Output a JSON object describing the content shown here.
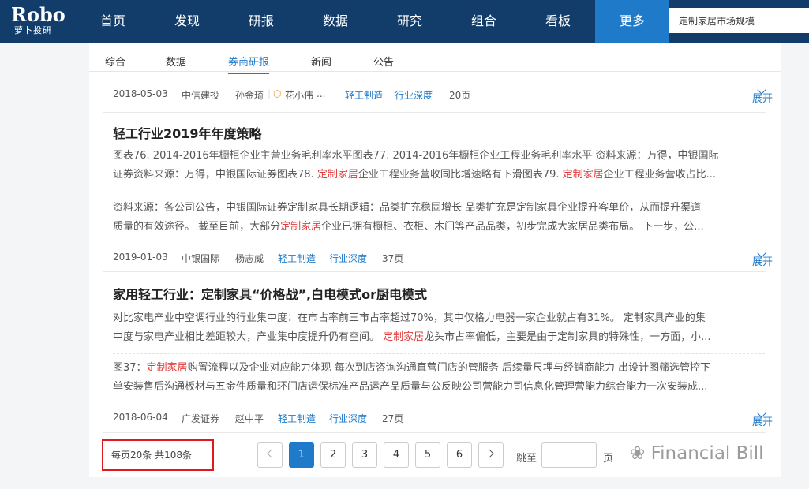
{
  "logo": {
    "brand": "Robo",
    "sub": "萝卜投研"
  },
  "nav": {
    "items": [
      "首页",
      "发现",
      "研报",
      "数据",
      "研究",
      "组合",
      "看板",
      "更多"
    ],
    "active_index": 7
  },
  "search": {
    "value": "定制家居市场规模"
  },
  "subtabs": {
    "items": [
      "综合",
      "数据",
      "券商研报",
      "新闻",
      "公告"
    ],
    "active_index": 2
  },
  "reports": [
    {
      "meta": {
        "date": "2018-05-03",
        "broker": "中信建投",
        "author1": "孙金琦",
        "author2": "花小伟",
        "ellipsis": "...",
        "tag1": "轻工制造",
        "tag2": "行业深度",
        "pages": "20页",
        "expand": "展开"
      }
    },
    {
      "title": "轻工行业2019年年度策略",
      "para1": [
        {
          "parts": [
            {
              "t": "图表76. 2014-2016年橱柜企业主营业务毛利率水平图表77. 2014-2016年橱柜企业工程业务毛利率水平 资料来源：万得，中银国际",
              "hl": false
            }
          ]
        },
        {
          "parts": [
            {
              "t": "证券资料来源：万得，中银国际证券图表78. ",
              "hl": false
            },
            {
              "t": "定制家居",
              "hl": true
            },
            {
              "t": "企业工程业务营收同比增速略有下滑图表79. ",
              "hl": false
            },
            {
              "t": "定制家居",
              "hl": true
            },
            {
              "t": "企业工程业务营收占比...",
              "hl": false
            }
          ]
        }
      ],
      "para2": [
        {
          "parts": [
            {
              "t": "资料来源：各公司公告，中银国际证券定制家具长期逻辑：品类扩充稳固增长 品类扩充是定制家具企业提升客单价，从而提升渠道",
              "hl": false
            }
          ]
        },
        {
          "parts": [
            {
              "t": "质量的有效途径。 截至目前，大部分",
              "hl": false
            },
            {
              "t": "定制家居",
              "hl": true
            },
            {
              "t": "企业已拥有橱柜、衣柜、木门等产品品类，初步完成大家居品类布局。 下一步，公...",
              "hl": false
            }
          ]
        }
      ],
      "meta": {
        "date": "2019-01-03",
        "broker": "中银国际",
        "author1": "杨志威",
        "tag1": "轻工制造",
        "tag2": "行业深度",
        "pages": "37页",
        "expand": "展开"
      }
    },
    {
      "title": "家用轻工行业：定制家具“价格战”,白电模式or厨电模式",
      "para1": [
        {
          "parts": [
            {
              "t": "对比家电产业中空调行业的行业集中度：在市占率前三市占率超过70%，其中仅格力电器一家企业就占有31%。 定制家具产业的集",
              "hl": false
            }
          ]
        },
        {
          "parts": [
            {
              "t": "中度与家电产业相比差距较大，产业集中度提升仍有空间。 ",
              "hl": false
            },
            {
              "t": "定制家居",
              "hl": true
            },
            {
              "t": "龙头市占率偏低，主要是由于定制家具的特殊性，一方面，小...",
              "hl": false
            }
          ]
        }
      ],
      "para2": [
        {
          "parts": [
            {
              "t": "图37：",
              "hl": false
            },
            {
              "t": "定制家居",
              "hl": true
            },
            {
              "t": "购置流程以及企业对应能力体现 每次到店咨询沟通直营门店的管服务 后续量尺埋与经销商能力 出设计图筛选管控下",
              "hl": false
            }
          ]
        },
        {
          "parts": [
            {
              "t": "单安装售后沟通板材与五金件质量和环门店运保标准产品运产品质量与公反映公司营能力司信息化管理营能力综合能力一次安装成...",
              "hl": false
            }
          ]
        }
      ],
      "meta": {
        "date": "2018-06-04",
        "broker": "广发证券",
        "author1": "赵中平",
        "tag1": "轻工制造",
        "tag2": "行业深度",
        "pages": "27页",
        "expand": "展开"
      }
    }
  ],
  "pagination": {
    "info": "每页20条 共108条",
    "pages": [
      "1",
      "2",
      "3",
      "4",
      "5",
      "6"
    ],
    "active": "1",
    "jump_label": "跳至",
    "jump_suffix": "页"
  },
  "watermark": {
    "text": "Financial Bill"
  }
}
